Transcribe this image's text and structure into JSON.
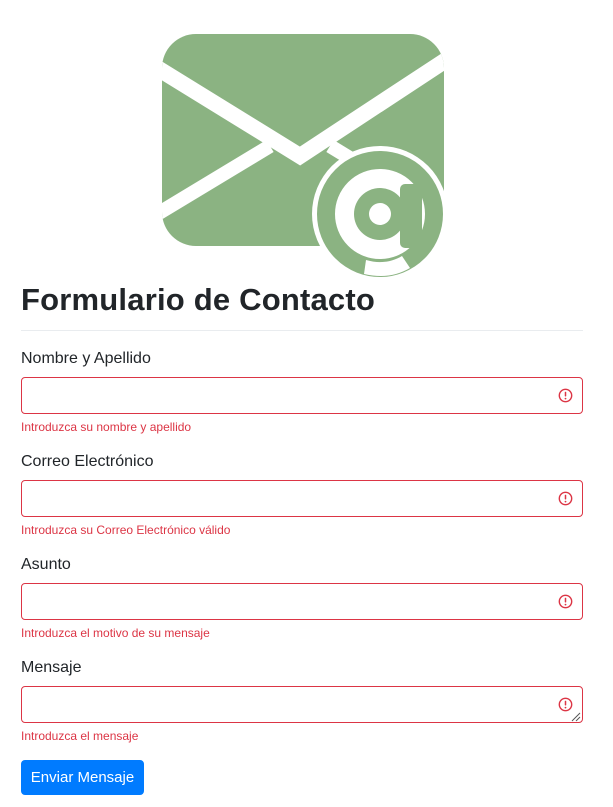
{
  "logo": {
    "icon": "email-at-icon",
    "color": "#8bb382"
  },
  "form": {
    "title": "Formulario de Contacto",
    "fields": [
      {
        "label": "Nombre y Apellido",
        "value": "",
        "feedback": "Introduzca su nombre y apellido"
      },
      {
        "label": "Correo Electrónico",
        "value": "",
        "feedback": "Introduzca su Correo Electrónico válido"
      },
      {
        "label": "Asunto",
        "value": "",
        "feedback": "Introduzca el motivo de su mensaje"
      },
      {
        "label": "Mensaje",
        "value": "",
        "feedback": "Introduzca el mensaje"
      }
    ],
    "submit_label": "Enviar Mensaje"
  },
  "colors": {
    "invalid": "#dc3545",
    "primary": "#007bff",
    "text": "#212529"
  }
}
